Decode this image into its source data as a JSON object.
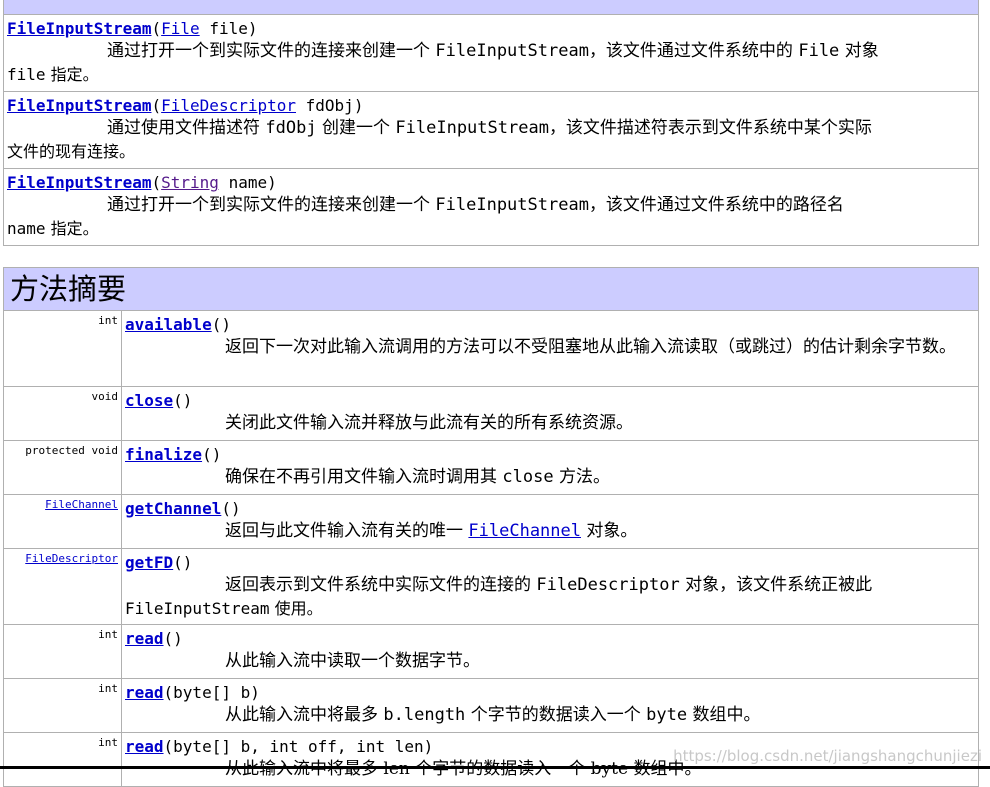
{
  "constructors": [
    {
      "name": "FileInputStream",
      "param_type": "File",
      "param_name": "file",
      "desc_pre": "通过打开一个到实际文件的连接来创建一个 ",
      "desc_code": "FileInputStream",
      "desc_post": "，该文件通过文件系统中的 ",
      "desc_code2": "File",
      "desc_post2": " 对象",
      "desc_line2_code": "file",
      "desc_line2": " 指定。"
    },
    {
      "name": "FileInputStream",
      "param_type": "FileDescriptor",
      "param_name": "fdObj",
      "desc_pre": "通过使用文件描述符 ",
      "desc_code": "fdObj",
      "desc_post": " 创建一个 ",
      "desc_code2": "FileInputStream",
      "desc_post2": "，该文件描述符表示到文件系统中某个实际",
      "desc_line2": "文件的现有连接。"
    },
    {
      "name": "FileInputStream",
      "param_type": "String",
      "param_name": "name",
      "desc_pre": "通过打开一个到实际文件的连接来创建一个 ",
      "desc_code": "FileInputStream",
      "desc_post": "，该文件通过文件系统中的路径名",
      "desc_line2_code": "name",
      "desc_line2": " 指定。"
    }
  ],
  "method_summary_title": "方法摘要",
  "methods": [
    {
      "type": "int",
      "name": "available",
      "params": "()",
      "desc": "返回下一次对此输入流调用的方法可以不受阻塞地从此输入流读取（或跳过）的估计剩余字节数。"
    },
    {
      "type": "void",
      "name": "close",
      "params": "()",
      "desc": "关闭此文件输入流并释放与此流有关的所有系统资源。"
    },
    {
      "type": "protected  void",
      "name": "finalize",
      "params": "()",
      "desc_pre": "确保在不再引用文件输入流时调用其 ",
      "desc_code": "close",
      "desc_post": " 方法。"
    },
    {
      "type": "FileChannel",
      "type_link": true,
      "name": "getChannel",
      "params": "()",
      "desc_pre": "返回与此文件输入流有关的唯一 ",
      "desc_link": "FileChannel",
      "desc_post": " 对象。"
    },
    {
      "type": "FileDescriptor",
      "type_link": true,
      "name": "getFD",
      "params": "()",
      "desc_pre": "返回表示到文件系统中实际文件的连接的 ",
      "desc_code": "FileDescriptor",
      "desc_post": " 对象，该文件系统正被此",
      "desc_line2_code": "FileInputStream",
      "desc_line2": " 使用。"
    },
    {
      "type": "int",
      "name": "read",
      "params": "()",
      "desc": "从此输入流中读取一个数据字节。"
    },
    {
      "type": "int",
      "name": "read",
      "params": "(byte[] b)",
      "desc_pre": "从此输入流中将最多 ",
      "desc_code": "b.length",
      "desc_post": " 个字节的数据读入一个 ",
      "desc_code2": "byte",
      "desc_post2": " 数组中。"
    },
    {
      "type": "int",
      "name": "read",
      "params": "(byte[] b,  int off,  int len)",
      "desc": "从此输入流中将最多 len 个字节的数据读入一个 byte 数组中。"
    }
  ],
  "watermark": "https://blog.csdn.net/jiangshangchunjiezi"
}
